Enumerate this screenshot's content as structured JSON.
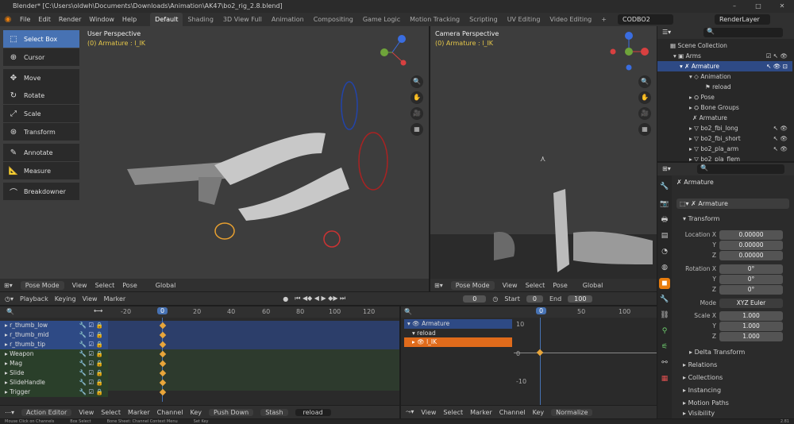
{
  "window": {
    "title": "Blender* [C:\\Users\\oldwh\\Documents\\Downloads\\Animation\\AK47\\bo2_rig_2.8.blend]"
  },
  "menu": [
    "File",
    "Edit",
    "Render",
    "Window",
    "Help"
  ],
  "workspaces": [
    "Default",
    "Shading",
    "3D View Full",
    "Animation",
    "Compositing",
    "Game Logic",
    "Motion Tracking",
    "Scripting",
    "UV Editing",
    "Video Editing"
  ],
  "scene": "CODBO2",
  "render_layer": "RenderLayer",
  "viewport_left": {
    "title": "User Perspective",
    "subtitle": "(0) Armature : l_IK",
    "mode": "Pose Mode",
    "menus": [
      "View",
      "Select",
      "Pose"
    ],
    "orient": "Global"
  },
  "viewport_right": {
    "title": "Camera Perspective",
    "subtitle": "(0) Armature : l_IK",
    "mode": "Pose Mode",
    "menus": [
      "View",
      "Select",
      "Pose"
    ],
    "orient": "Global"
  },
  "tools": [
    "Select Box",
    "Cursor",
    "Move",
    "Rotate",
    "Scale",
    "Transform",
    "Annotate",
    "Measure",
    "Breakdowner"
  ],
  "timeline": {
    "playback": "Playback",
    "keying": "Keying",
    "view": "View",
    "marker": "Marker",
    "current_frame": "0",
    "start_label": "Start",
    "start": "0",
    "end_label": "End",
    "end": "100"
  },
  "dopesheet": {
    "ticks": [
      "-20",
      "0",
      "20",
      "40",
      "60",
      "80",
      "100",
      "120"
    ],
    "channels": [
      "r_thumb_low",
      "r_thumb_mid",
      "r_thumb_tip",
      "Weapon",
      "Mag",
      "Slide",
      "SlideHandle",
      "Trigger"
    ],
    "mode": "Action Editor",
    "menus": [
      "View",
      "Select",
      "Marker",
      "Channel",
      "Key"
    ],
    "push_down": "Push Down",
    "stash": "Stash",
    "action": "reload"
  },
  "graph": {
    "ticks": [
      "0",
      "50",
      "100"
    ],
    "yticks": [
      "10",
      "0",
      "-10"
    ],
    "tree": [
      "Armature",
      "reload",
      "l_IK"
    ],
    "menus": [
      "View",
      "Select",
      "Marker",
      "Channel",
      "Key"
    ],
    "normalize": "Normalize"
  },
  "outliner": {
    "items": [
      "Scene Collection",
      "Arms",
      "Armature",
      "Animation",
      "reload",
      "Pose",
      "Bone Groups",
      "Armature",
      "bo2_fbi_long",
      "bo2_fbi_short",
      "bo2_pla_arm",
      "bo2_pla_flem"
    ]
  },
  "properties": {
    "object": "Armature",
    "data": "Armature",
    "transform": "Transform",
    "loc_label": "Location X",
    "loc": [
      "0.00000",
      "0.00000",
      "0.00000"
    ],
    "rot_label": "Rotation X",
    "rot": [
      "0°",
      "0°",
      "0°"
    ],
    "mode_label": "Mode",
    "mode": "XYZ Euler",
    "scale_label": "Scale X",
    "scale": [
      "1.000",
      "1.000",
      "1.000"
    ],
    "axes": [
      "Y",
      "Z"
    ],
    "sections": [
      "Delta Transform",
      "Relations",
      "Collections",
      "Instancing",
      "Motion Paths",
      "Visibility"
    ]
  },
  "status": [
    "Mouse Click on Channels",
    "Box Select",
    "Bone Sheet: Channel Context Menu",
    "Set Key"
  ],
  "version": "2.81"
}
